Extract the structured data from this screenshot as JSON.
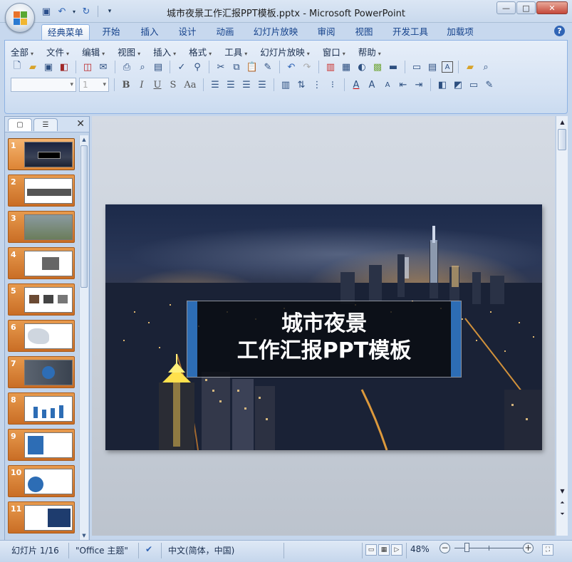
{
  "window": {
    "title": "城市夜景工作汇报PPT模板.pptx - Microsoft PowerPoint",
    "controls": [
      "—",
      "□",
      "✕"
    ]
  },
  "quick_access": [
    "save",
    "undo",
    "redo",
    "customize"
  ],
  "ribbon_tabs": [
    "经典菜单",
    "开始",
    "插入",
    "设计",
    "动画",
    "幻灯片放映",
    "审阅",
    "视图",
    "开发工具",
    "加载项"
  ],
  "active_tab": "经典菜单",
  "menu_items": [
    "全部",
    "文件",
    "编辑",
    "视图",
    "插入",
    "格式",
    "工具",
    "幻灯片放映",
    "窗口",
    "帮助"
  ],
  "format_bar": {
    "font_size_value": "1",
    "bold": "B",
    "italic": "I",
    "underline": "U",
    "shadow": "S",
    "case": "Aa"
  },
  "slide": {
    "title_line1": "城市夜景",
    "title_line2": "工作汇报PPT模板"
  },
  "thumbnails": [
    "1",
    "2",
    "3",
    "4",
    "5",
    "6",
    "7",
    "8",
    "9",
    "10",
    "11"
  ],
  "status": {
    "slide_indicator": "幻灯片 1/16",
    "theme": "\"Office 主题\"",
    "language": "中文(简体，中国)",
    "zoom": "48%"
  },
  "colors": {
    "accent": "#2d6db5",
    "thumb_orange": "#dd8434",
    "ribbon_bg": "#d5e2f3"
  }
}
